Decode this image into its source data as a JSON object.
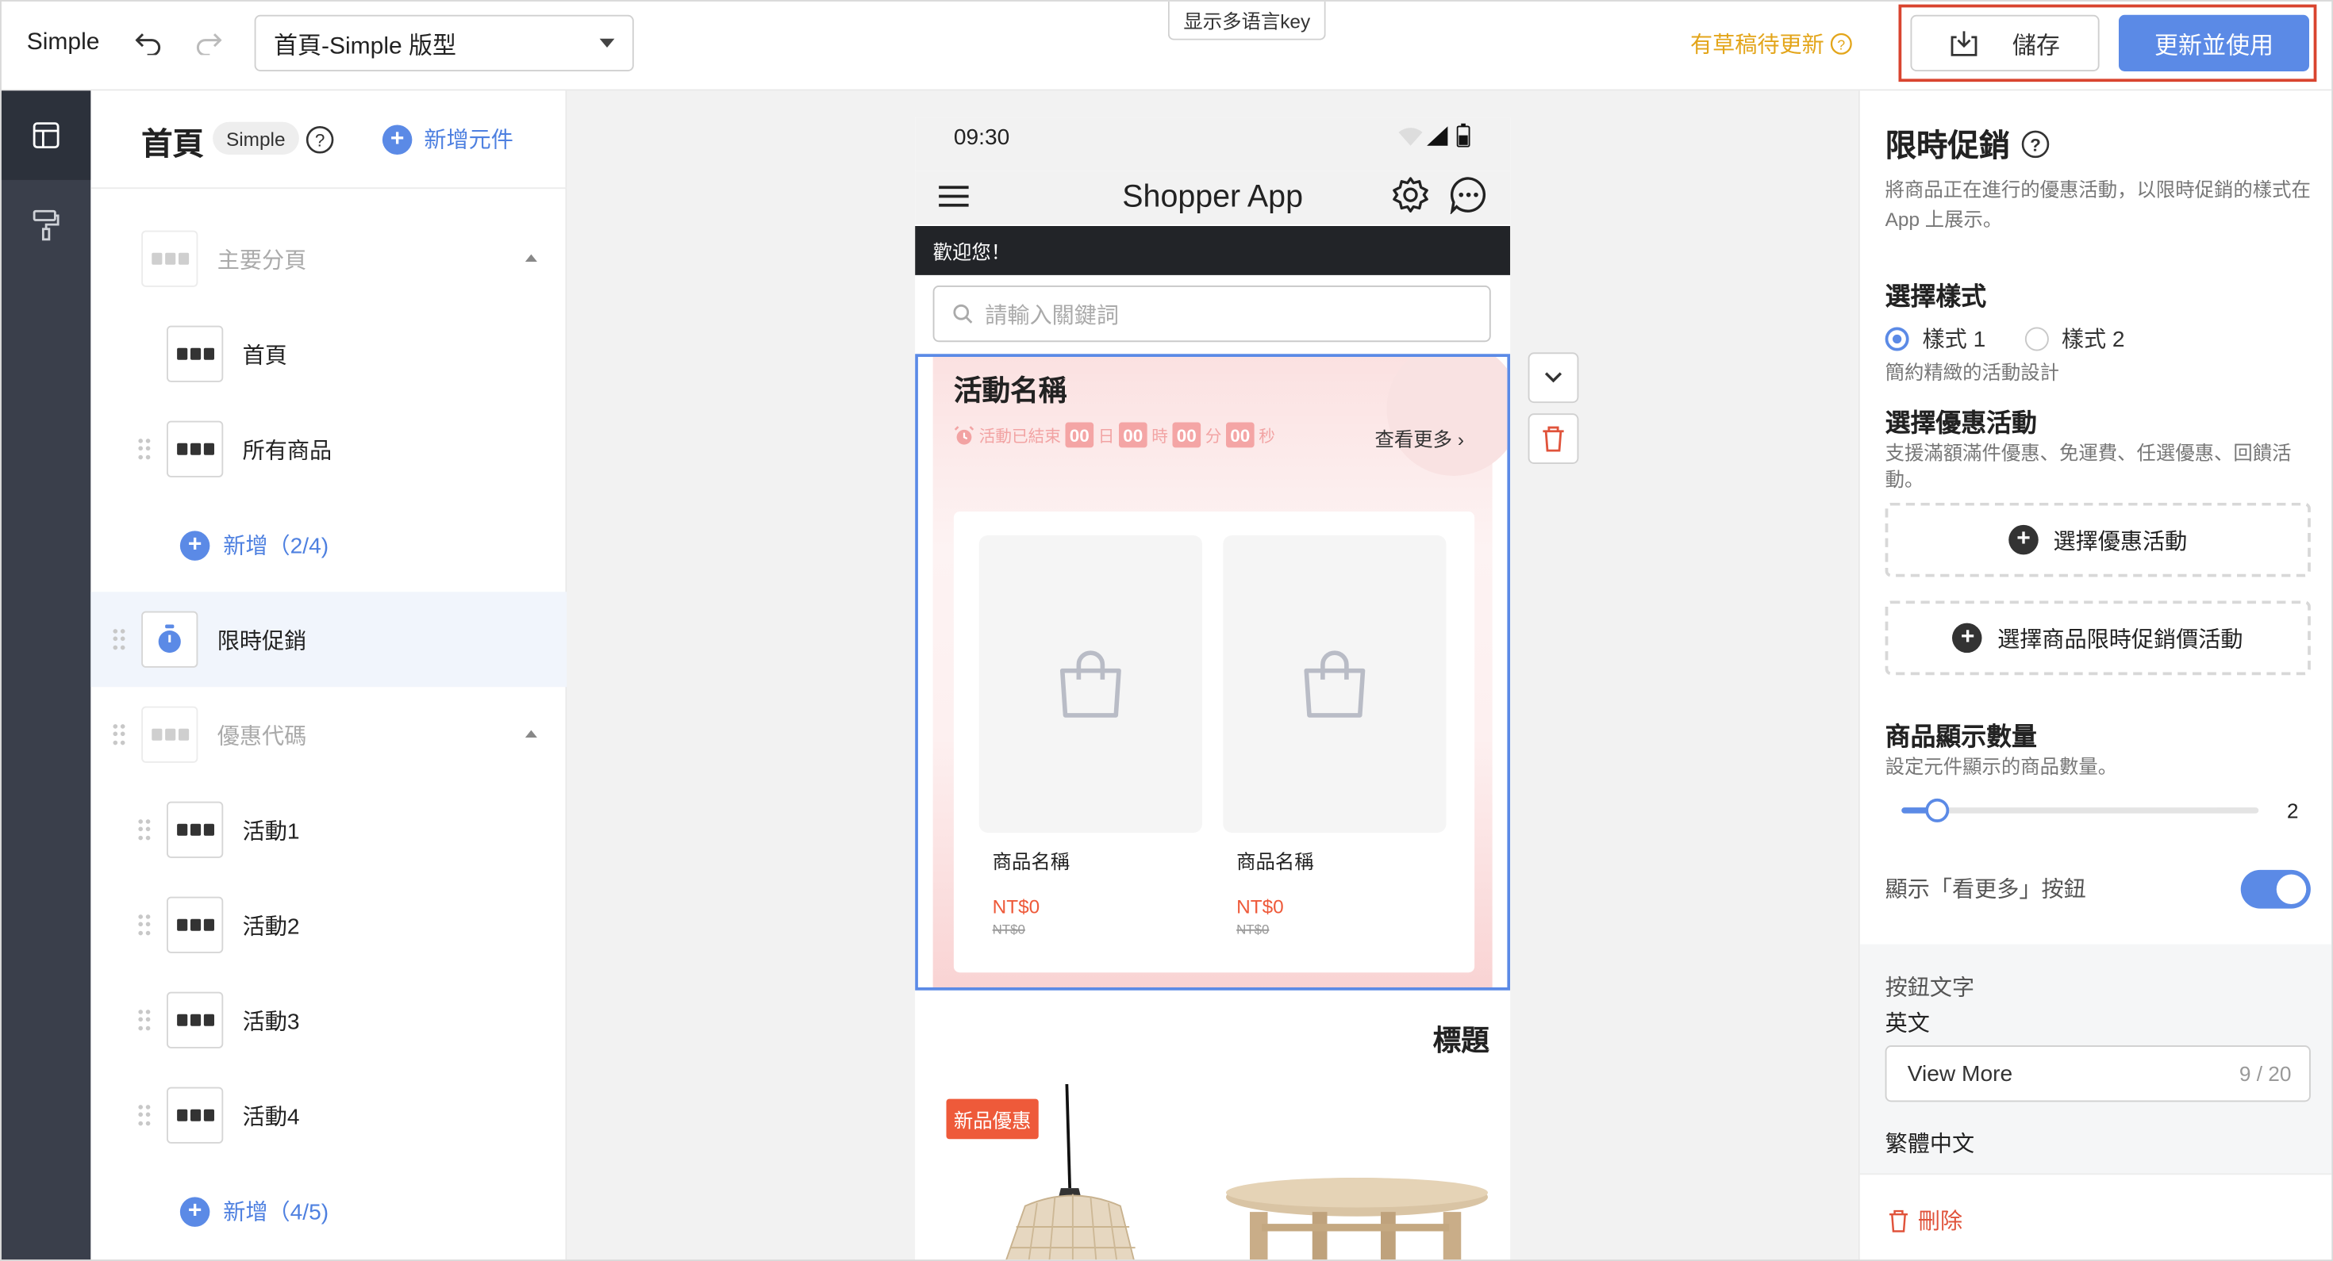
{
  "topbar": {
    "app_name": "Simple",
    "template_select": "首頁-Simple 版型",
    "i18n_key_button": "显示多语言key",
    "draft_note": "有草稿待更新",
    "save_label": "儲存",
    "publish_label": "更新並使用"
  },
  "tree": {
    "title": "首頁",
    "badge": "Simple",
    "add_component": "新增元件",
    "items": [
      {
        "label": "主要分頁"
      },
      {
        "label": "首頁"
      },
      {
        "label": "所有商品"
      },
      {
        "label": "新增（2/4)"
      },
      {
        "label": "限時促銷"
      },
      {
        "label": "優惠代碼"
      },
      {
        "label": "活動1"
      },
      {
        "label": "活動2"
      },
      {
        "label": "活動3"
      },
      {
        "label": "活動4"
      },
      {
        "label": "新增（4/5)"
      }
    ]
  },
  "phone": {
    "time": "09:30",
    "app_title": "Shopper App",
    "welcome": "歡迎您！",
    "search_placeholder": "請輸入關鍵詞",
    "flash": {
      "title": "活動名稱",
      "ended_label": "活動已結束",
      "days": "00",
      "day_unit": "日",
      "hours": "00",
      "hour_unit": "時",
      "minutes": "00",
      "minute_unit": "分",
      "seconds": "00",
      "second_unit": "秒",
      "see_more": "查看更多",
      "products": [
        {
          "name": "商品名稱",
          "price": "NT$0",
          "old_price": "NT$0"
        },
        {
          "name": "商品名稱",
          "price": "NT$0",
          "old_price": "NT$0"
        }
      ]
    },
    "section2_title": "標題",
    "badge_new": "新品優惠"
  },
  "panel": {
    "title": "限時促銷",
    "description": "將商品正在進行的優惠活動，以限時促銷的樣式在 App 上展示。",
    "style_heading": "選擇樣式",
    "style_1": "樣式 1",
    "style_2": "樣式 2",
    "style_note": "簡約精緻的活動設計",
    "promo_heading": "選擇優惠活動",
    "promo_desc": "支援滿額滿件優惠、免運費、任選優惠、回饋活動。",
    "promo_button": "選擇優惠活動",
    "flash_price_button": "選擇商品限時促銷價活動",
    "count_heading": "商品顯示數量",
    "count_desc": "設定元件顯示的商品數量。",
    "count_value": "2",
    "count_fraction": 0.1,
    "see_more_toggle_label": "顯示「看更多」按鈕",
    "button_text_label": "按鈕文字",
    "english_label": "英文",
    "english_value": "View More",
    "english_count": "9 / 20",
    "zh_label": "繁體中文",
    "delete_label": "刪除"
  },
  "colors": {
    "accent": "#5b8ae6",
    "danger": "#e0533b",
    "warning": "#e3a51a",
    "price": "#ee5a3a"
  }
}
